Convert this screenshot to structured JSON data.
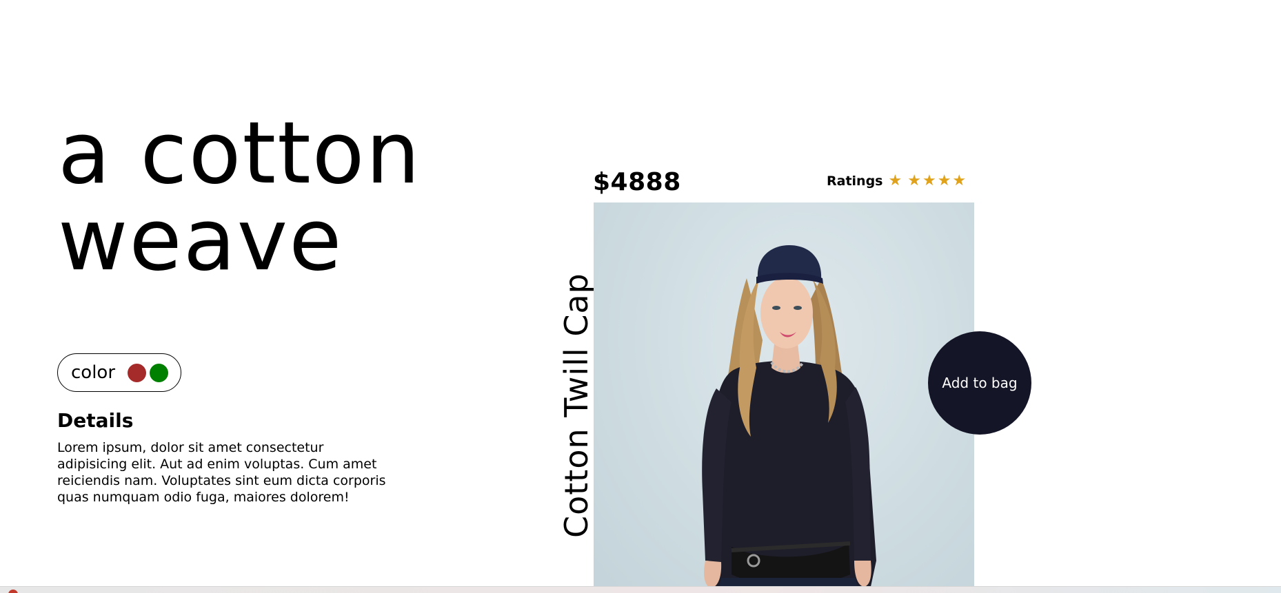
{
  "hero": {
    "line1": "a cotton",
    "line2": "weave"
  },
  "color_picker": {
    "label": "color",
    "swatches": [
      {
        "name": "red",
        "color": "#a52a2a"
      },
      {
        "name": "green",
        "color": "#008000"
      }
    ]
  },
  "details": {
    "title": "Details",
    "text": "Lorem ipsum, dolor sit amet consectetur adipisicing elit. Aut ad enim voluptas. Cum amet reiciendis nam. Voluptates sint eum dicta corporis quas numquam odio fuga, maiores dolorem!"
  },
  "product": {
    "price": "$4888",
    "ratings_label": "Ratings",
    "rating": 5,
    "star_color": "#e0a21a",
    "name": "Cotton Twill Cap",
    "add_to_bag_label": "Add to bag",
    "add_to_bag_color": "#151528"
  }
}
